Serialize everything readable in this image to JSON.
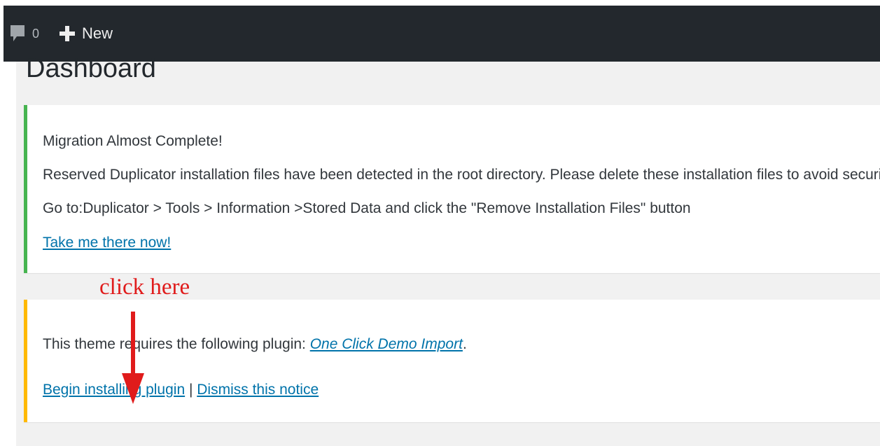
{
  "admin_bar": {
    "comments_icon": "speech-bubble-icon",
    "comments_count": "0",
    "new_icon": "plus-icon",
    "new_label": "New",
    "bg_color": "#23282d"
  },
  "page": {
    "title": "Dashboard"
  },
  "notices": {
    "migration": {
      "title": "Migration Almost Complete!",
      "text": "Reserved Duplicator installation files have been detected in the root directory. Please delete these installation files to avoid security issues.",
      "goto_text": "Go to:Duplicator > Tools > Information >Stored Data and click the \"Remove Installation Files\" button",
      "link_label": "Take me there now!",
      "accent_color": "#46b450"
    },
    "plugin": {
      "text_before": "This theme requires the following plugin: ",
      "plugin_name": "One Click Demo Import",
      "text_after": ".",
      "begin_label": "Begin installing plugin",
      "separator": " | ",
      "dismiss_label": "Dismiss this notice",
      "accent_color": "#ffb900"
    }
  },
  "annotation": {
    "label": "click here",
    "arrow_icon": "red-down-arrow-icon",
    "color": "#e01b1b"
  }
}
